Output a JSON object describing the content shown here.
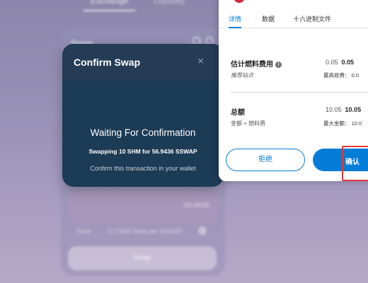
{
  "background": {
    "tabs": [
      "Exchange",
      "Liquidity"
    ],
    "swap_card": {
      "title": "Swap",
      "amount": "56.9436",
      "price_label": "Price",
      "price_value": "0.17563 SHM per SSWAP",
      "swap_button": "Swap"
    }
  },
  "modal": {
    "title": "Confirm Swap",
    "close_symbol": "×",
    "status": "Waiting For Confirmation",
    "swapping": "Swapping 10 SHM for 56.9436 SSWAP",
    "hint": "Confirm this transaction in your wallet"
  },
  "wallet": {
    "tabs": [
      "详情",
      "数据",
      "十六进制文件"
    ],
    "active_tab": 0,
    "gas": {
      "label": "估计燃料费用",
      "info_symbol": "i",
      "value_plain": "0.05",
      "value_bold": "0.05",
      "sub_label": "推荐站点",
      "sub_right": "最高收费：  0.0"
    },
    "total": {
      "label": "总额",
      "value_plain": "10.05",
      "value_bold": "10.05",
      "sub_label": "金额 + 燃料费",
      "sub_right": "最大金额：  10.0"
    },
    "reject_button": "拒绝",
    "confirm_button": "确认"
  },
  "colors": {
    "accent": "#037dd6",
    "modal_bg": "#1c3b55",
    "highlight": "#e53935"
  }
}
